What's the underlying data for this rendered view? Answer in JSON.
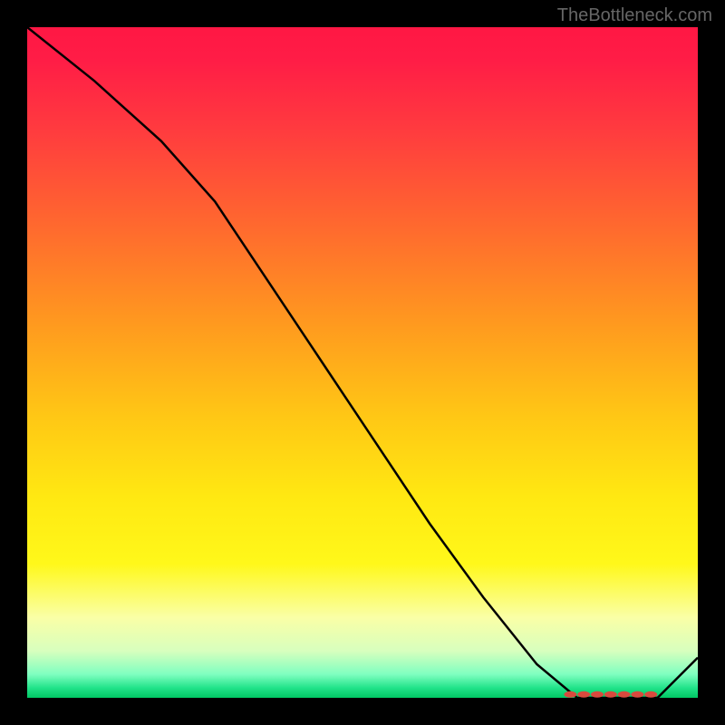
{
  "watermark": "TheBottleneck.com",
  "chart_data": {
    "type": "line",
    "title": "",
    "xlabel": "",
    "ylabel": "",
    "xlim": [
      0,
      100
    ],
    "ylim": [
      0,
      100
    ],
    "gradient_stops": [
      {
        "offset": 0.0,
        "color": "#ff1744"
      },
      {
        "offset": 0.05,
        "color": "#ff1d46"
      },
      {
        "offset": 0.15,
        "color": "#ff3a3f"
      },
      {
        "offset": 0.3,
        "color": "#ff6a2e"
      },
      {
        "offset": 0.45,
        "color": "#ff9c1e"
      },
      {
        "offset": 0.58,
        "color": "#ffc715"
      },
      {
        "offset": 0.7,
        "color": "#ffe812"
      },
      {
        "offset": 0.8,
        "color": "#fff81a"
      },
      {
        "offset": 0.88,
        "color": "#faffa6"
      },
      {
        "offset": 0.93,
        "color": "#d8ffbe"
      },
      {
        "offset": 0.965,
        "color": "#7fffc0"
      },
      {
        "offset": 0.985,
        "color": "#22e38a"
      },
      {
        "offset": 1.0,
        "color": "#00c864"
      }
    ],
    "series": [
      {
        "name": "bottleneck-curve",
        "x": [
          0,
          10,
          20,
          28,
          36,
          44,
          52,
          60,
          68,
          76,
          82,
          86,
          90,
          94,
          100
        ],
        "y": [
          100,
          92,
          83,
          74,
          62,
          50,
          38,
          26,
          15,
          5,
          0,
          0,
          0,
          0,
          6
        ]
      }
    ],
    "markers": {
      "name": "optimal-range-markers",
      "x": [
        81,
        83,
        85,
        87,
        89,
        91,
        93
      ],
      "y": [
        0.5,
        0.5,
        0.5,
        0.5,
        0.5,
        0.5,
        0.5
      ],
      "color": "#d84a3e"
    }
  }
}
